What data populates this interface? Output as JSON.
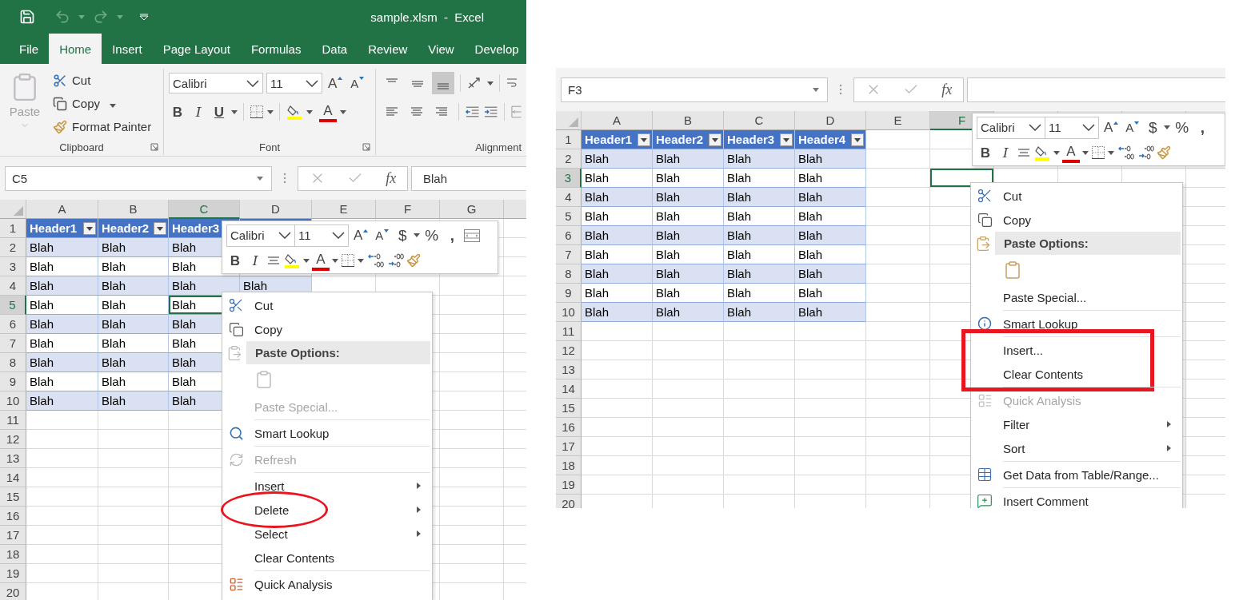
{
  "left_excel": {
    "title": "sample.xlsm  -  Excel",
    "quick_access": {
      "undo_enabled": false,
      "redo_enabled": false
    },
    "tabs": [
      {
        "label": "File",
        "selected": false
      },
      {
        "label": "Home",
        "selected": true
      },
      {
        "label": "Insert",
        "selected": false
      },
      {
        "label": "Page Layout",
        "selected": false
      },
      {
        "label": "Formulas",
        "selected": false
      },
      {
        "label": "Data",
        "selected": false
      },
      {
        "label": "Review",
        "selected": false
      },
      {
        "label": "View",
        "selected": false
      },
      {
        "label": "Develop",
        "selected": false
      }
    ],
    "ribbon": {
      "clipboard": {
        "paste": "Paste",
        "paste_disabled": true,
        "cut": "Cut",
        "copy": "Copy",
        "format_painter": "Format Painter",
        "label": "Clipboard"
      },
      "font": {
        "font_name": "Calibri",
        "font_size": "11",
        "grow": "A",
        "shrink": "A",
        "bold": "B",
        "italic": "I",
        "underline": "U",
        "font_color": "A",
        "label": "Font"
      },
      "alignment": {
        "bottom_align_selected": true,
        "label": "Alignment"
      }
    },
    "formula_bar": {
      "name_box": "C5",
      "function_label": "fx",
      "value": "Blah"
    },
    "sheet": {
      "columns": [
        {
          "label": "A",
          "selected": false
        },
        {
          "label": "B",
          "selected": false
        },
        {
          "label": "C",
          "selected": true
        },
        {
          "label": "D",
          "selected": false
        },
        {
          "label": "E",
          "selected": false
        },
        {
          "label": "F",
          "selected": false
        },
        {
          "label": "G",
          "selected": false
        }
      ],
      "rows": [
        {
          "label": "1",
          "selected": false
        },
        {
          "label": "2",
          "selected": false
        },
        {
          "label": "3",
          "selected": false
        },
        {
          "label": "4",
          "selected": false
        },
        {
          "label": "5",
          "selected": true
        },
        {
          "label": "6",
          "selected": false
        },
        {
          "label": "7",
          "selected": false
        },
        {
          "label": "8",
          "selected": false
        },
        {
          "label": "9",
          "selected": false
        },
        {
          "label": "10",
          "selected": false
        },
        {
          "label": "11",
          "selected": false
        },
        {
          "label": "12",
          "selected": false
        },
        {
          "label": "13",
          "selected": false
        },
        {
          "label": "14",
          "selected": false
        },
        {
          "label": "15",
          "selected": false
        },
        {
          "label": "16",
          "selected": false
        },
        {
          "label": "17",
          "selected": false
        },
        {
          "label": "18",
          "selected": false
        },
        {
          "label": "19",
          "selected": false
        },
        {
          "label": "20",
          "selected": false
        }
      ],
      "table": {
        "header": [
          {
            "label": "Header1",
            "filter_button": true
          },
          {
            "label": "Header2",
            "filter_button": true
          },
          {
            "label": "Header3"
          }
        ],
        "rows": [
          [
            "Blah",
            "Blah",
            "Blah"
          ],
          [
            "Blah",
            "Blah",
            "Blah"
          ],
          [
            "Blah",
            "Blah",
            "Blah",
            "Blah"
          ],
          [
            "Blah",
            "Blah",
            "Blah"
          ],
          [
            "Blah",
            "Blah",
            "Blah"
          ],
          [
            "Blah",
            "Blah",
            "Blah"
          ],
          [
            "Blah",
            "Blah",
            "Blah"
          ],
          [
            "Blah",
            "Blah",
            "Blah"
          ],
          [
            "Blah",
            "Blah",
            "Blah"
          ]
        ]
      }
    },
    "mini_toolbar": {
      "font_name": "Calibri",
      "font_size": "11",
      "grow": "A",
      "shrink": "A",
      "currency": "$",
      "percent": "%",
      "comma": ",",
      "bold": "B",
      "italic": "I",
      "font_color": "A",
      "merge_button": true
    },
    "context_menu": {
      "highlight": {
        "kind": "ellipse"
      },
      "items": [
        {
          "label": "Cut",
          "kind": "cut",
          "disabled": false,
          "submenu": false,
          "divider": false,
          "marked": false
        },
        {
          "label": "Copy",
          "kind": "copy",
          "disabled": false,
          "submenu": false,
          "divider": false,
          "marked": false
        },
        {
          "label": "Paste Options:",
          "kind": "header",
          "disabled": true
        },
        {
          "kind": "paste",
          "disabled": true
        },
        {
          "label": "Paste Special...",
          "kind": "text",
          "disabled": true,
          "submenu": false,
          "divider": false,
          "marked": false
        },
        {
          "label": "Smart Lookup",
          "kind": "lookup",
          "disabled": false,
          "submenu": false,
          "divider": true,
          "marked": false
        },
        {
          "label": "Refresh",
          "kind": "refresh",
          "disabled": true,
          "submenu": false,
          "divider": true,
          "marked": false
        },
        {
          "label": "Insert",
          "kind": "text",
          "disabled": false,
          "submenu": true,
          "divider": true,
          "marked": false
        },
        {
          "label": "Delete",
          "kind": "text",
          "disabled": false,
          "submenu": true,
          "divider": false,
          "marked": true
        },
        {
          "label": "Select",
          "kind": "text",
          "disabled": false,
          "submenu": true,
          "divider": false,
          "marked": false
        },
        {
          "label": "Clear Contents",
          "kind": "text",
          "disabled": false,
          "submenu": false,
          "divider": false,
          "marked": false
        },
        {
          "label": "Quick Analysis",
          "kind": "analysis",
          "disabled": false,
          "submenu": false,
          "divider": true,
          "marked": false
        }
      ]
    }
  },
  "right_excel": {
    "formula_bar": {
      "name_box": "F3",
      "function_label": "fx"
    },
    "sheet": {
      "columns": [
        {
          "label": "A",
          "selected": false
        },
        {
          "label": "B",
          "selected": false
        },
        {
          "label": "C",
          "selected": false
        },
        {
          "label": "D",
          "selected": false
        },
        {
          "label": "E",
          "selected": false
        },
        {
          "label": "F",
          "selected": true
        }
      ],
      "rows": [
        {
          "label": "1",
          "selected": false
        },
        {
          "label": "2",
          "selected": false
        },
        {
          "label": "3",
          "selected": true
        },
        {
          "label": "4",
          "selected": false
        },
        {
          "label": "5",
          "selected": false
        },
        {
          "label": "6",
          "selected": false
        },
        {
          "label": "7",
          "selected": false
        },
        {
          "label": "8",
          "selected": false
        },
        {
          "label": "9",
          "selected": false
        },
        {
          "label": "10",
          "selected": false
        },
        {
          "label": "11",
          "selected": false
        },
        {
          "label": "12",
          "selected": false
        },
        {
          "label": "13",
          "selected": false
        },
        {
          "label": "14",
          "selected": false
        },
        {
          "label": "15",
          "selected": false
        },
        {
          "label": "16",
          "selected": false
        },
        {
          "label": "17",
          "selected": false
        },
        {
          "label": "18",
          "selected": false
        },
        {
          "label": "19",
          "selected": false
        },
        {
          "label": "20",
          "selected": false
        }
      ],
      "table": {
        "header": [
          {
            "label": "Header1",
            "filter_button": true
          },
          {
            "label": "Header2",
            "filter_button": true
          },
          {
            "label": "Header3",
            "filter_button": true
          },
          {
            "label": "Header4",
            "filter_button": true
          }
        ],
        "rows": [
          [
            "Blah",
            "Blah",
            "Blah",
            "Blah"
          ],
          [
            "Blah",
            "Blah",
            "Blah",
            "Blah"
          ],
          [
            "Blah",
            "Blah",
            "Blah",
            "Blah"
          ],
          [
            "Blah",
            "Blah",
            "Blah",
            "Blah"
          ],
          [
            "Blah",
            "Blah",
            "Blah",
            "Blah"
          ],
          [
            "Blah",
            "Blah",
            "Blah",
            "Blah"
          ],
          [
            "Blah",
            "Blah",
            "Blah",
            "Blah"
          ],
          [
            "Blah",
            "Blah",
            "Blah",
            "Blah"
          ],
          [
            "Blah",
            "Blah",
            "Blah",
            "Blah"
          ]
        ]
      }
    },
    "mini_toolbar": {
      "font_name": "Calibri",
      "font_size": "11",
      "grow": "A",
      "shrink": "A",
      "currency": "$",
      "percent": "%",
      "comma": ",",
      "bold": "B",
      "italic": "I",
      "font_color": "A"
    },
    "context_menu": {
      "highlight": {
        "kind": "rectangle"
      },
      "items": [
        {
          "label": "Cut",
          "kind": "cut",
          "disabled": false,
          "submenu": false,
          "divider": false,
          "marked": false
        },
        {
          "label": "Copy",
          "kind": "copy",
          "disabled": false,
          "submenu": false,
          "divider": false,
          "marked": false
        },
        {
          "label": "Paste Options:",
          "kind": "header",
          "disabled": false
        },
        {
          "kind": "paste",
          "disabled": false
        },
        {
          "label": "Paste Special...",
          "kind": "text",
          "disabled": false,
          "submenu": false,
          "divider": false,
          "marked": false
        },
        {
          "label": "Smart Lookup",
          "kind": "info",
          "disabled": false,
          "submenu": false,
          "divider": true,
          "marked": false
        },
        {
          "label": "Insert...",
          "kind": "text",
          "disabled": false,
          "submenu": false,
          "divider": true,
          "marked": true
        },
        {
          "label": "Clear Contents",
          "kind": "text",
          "disabled": false,
          "submenu": false,
          "divider": false,
          "marked": true
        },
        {
          "label": "Quick Analysis",
          "kind": "analysis",
          "disabled": true,
          "submenu": false,
          "divider": true,
          "marked": false
        },
        {
          "label": "Filter",
          "kind": "text",
          "disabled": false,
          "submenu": true,
          "divider": false,
          "marked": false
        },
        {
          "label": "Sort",
          "kind": "text",
          "disabled": false,
          "submenu": true,
          "divider": false,
          "marked": false
        },
        {
          "label": "Get Data from Table/Range...",
          "kind": "table",
          "disabled": false,
          "submenu": false,
          "divider": true,
          "marked": false
        },
        {
          "label": "Insert Comment",
          "kind": "comment",
          "disabled": false,
          "submenu": false,
          "divider": true,
          "marked": false
        }
      ]
    }
  }
}
